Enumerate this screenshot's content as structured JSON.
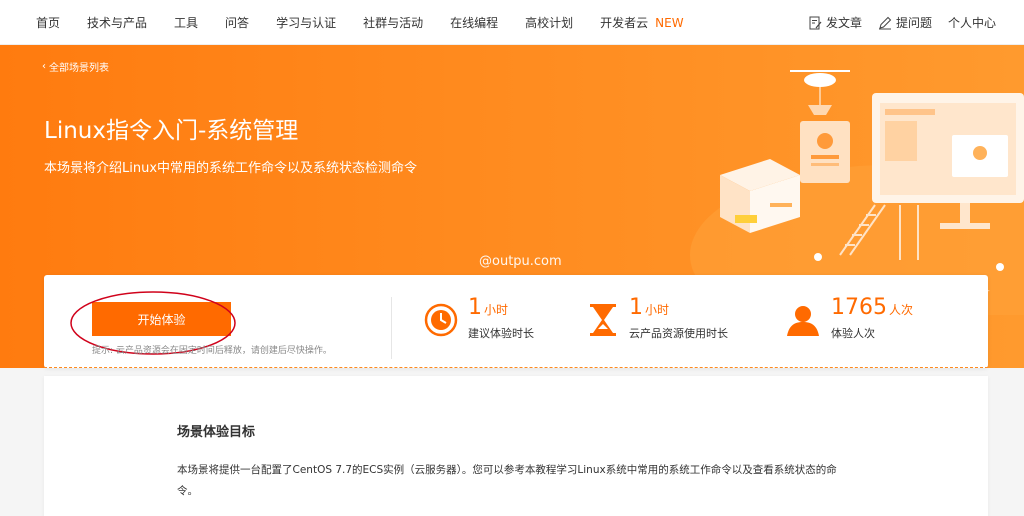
{
  "nav": {
    "items": [
      "首页",
      "技术与产品",
      "工具",
      "问答",
      "学习与认证",
      "社群与活动",
      "在线编程",
      "高校计划",
      "开发者云"
    ],
    "new_badge": "NEW",
    "right": {
      "post_article": "发文章",
      "ask_question": "提问题",
      "personal_center": "个人中心"
    }
  },
  "hero": {
    "back_link": "全部场景列表",
    "title": "Linux指令入门-系统管理",
    "subtitle": "本场景将介绍Linux中常用的系统工作命令以及系统状态检测命令",
    "watermark": "@outpu.com"
  },
  "stats": {
    "start_button": "开始体验",
    "hint": "提示: 云产品资源会在固定时间后释放，请创建后尽快操作。",
    "items": [
      {
        "icon": "clock-icon",
        "value": "1",
        "unit": "小时",
        "label": "建议体验时长"
      },
      {
        "icon": "hourglass-icon",
        "value": "1",
        "unit": "小时",
        "label": "云产品资源使用时长"
      },
      {
        "icon": "user-icon",
        "value": "1765",
        "unit": "人次",
        "label": "体验人次"
      }
    ]
  },
  "content": {
    "section_title": "场景体验目标",
    "section_text": "本场景将提供一台配置了CentOS 7.7的ECS实例（云服务器）。您可以参考本教程学习Linux系统中常用的系统工作命令以及查看系统状态的命令。"
  },
  "colors": {
    "brand_orange": "#ff6a00",
    "hero_orange": "#ff8a1e",
    "annotation_red": "#d0021b"
  }
}
